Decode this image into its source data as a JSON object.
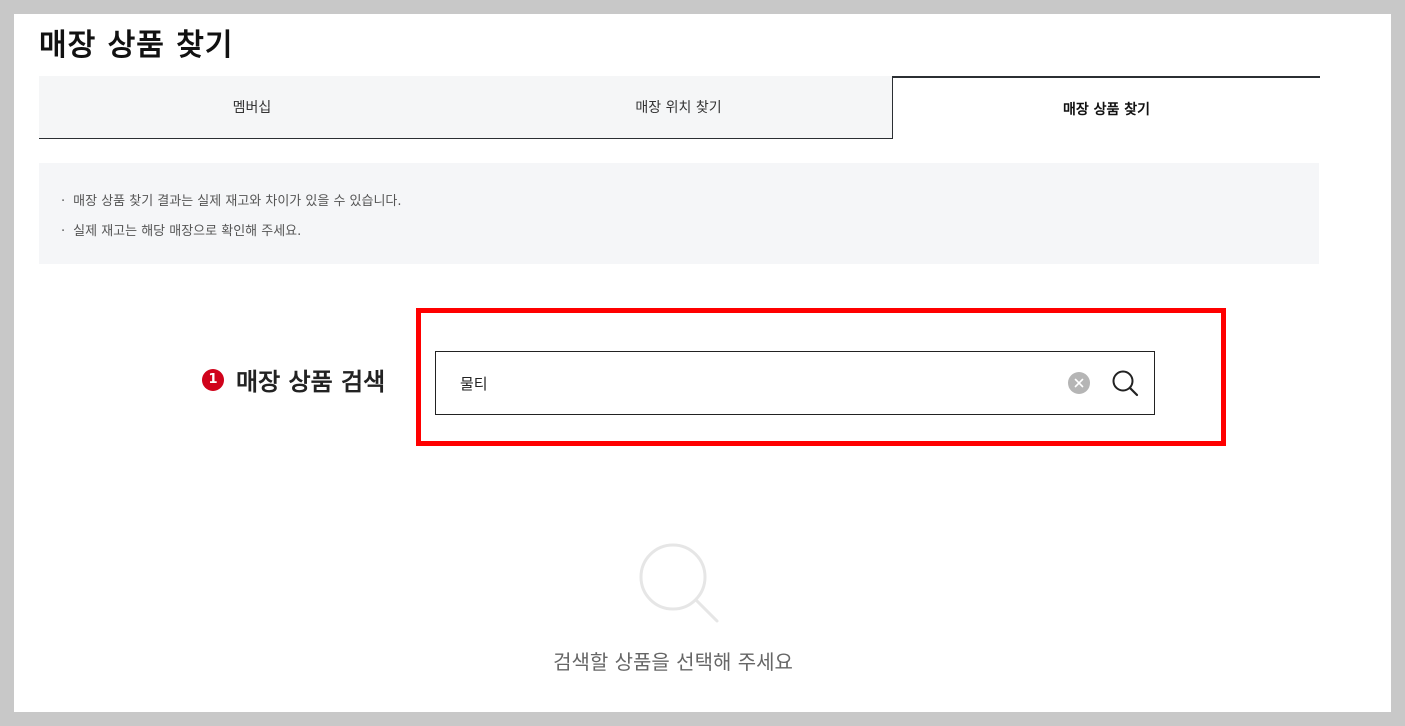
{
  "page": {
    "title": "매장 상품 찾기"
  },
  "tabs": [
    {
      "label": "멤버십",
      "active": false
    },
    {
      "label": "매장 위치 찾기",
      "active": false
    },
    {
      "label": "매장 상품 찾기",
      "active": true
    }
  ],
  "notice": {
    "items": [
      "매장 상품 찾기 결과는 실제 재고와 차이가 있을 수 있습니다.",
      "실제 재고는 해당 매장으로 확인해 주세요."
    ]
  },
  "search": {
    "step_number": "1",
    "label": "매장 상품 검색",
    "value": "물티",
    "clear_icon": "clear-circle-icon",
    "search_icon": "search-icon"
  },
  "empty_state": {
    "icon": "search-magnifier-icon",
    "message": "검색할 상품을 선택해 주세요"
  },
  "colors": {
    "accent_red": "#d0021b",
    "highlight_red": "#ff0000",
    "tab_border": "#2b2f33",
    "notice_bg": "#f5f6f8"
  }
}
